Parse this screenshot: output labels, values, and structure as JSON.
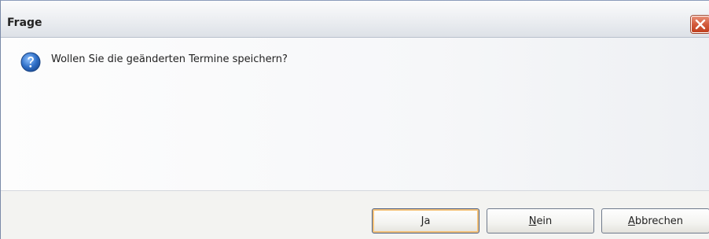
{
  "window": {
    "title": "Frage"
  },
  "dialog": {
    "icon": "question-icon",
    "message": "Wollen Sie die geänderten Termine speichern?"
  },
  "buttons": {
    "yes": {
      "mnemonic": "J",
      "rest": "a"
    },
    "no": {
      "mnemonic": "N",
      "rest": "ein"
    },
    "cancel": {
      "mnemonic": "A",
      "rest": "bbrechen"
    }
  },
  "colors": {
    "accent_default_button": "#f4c27a",
    "close_button": "#d25a3c",
    "question_icon": "#2f6fc7"
  }
}
